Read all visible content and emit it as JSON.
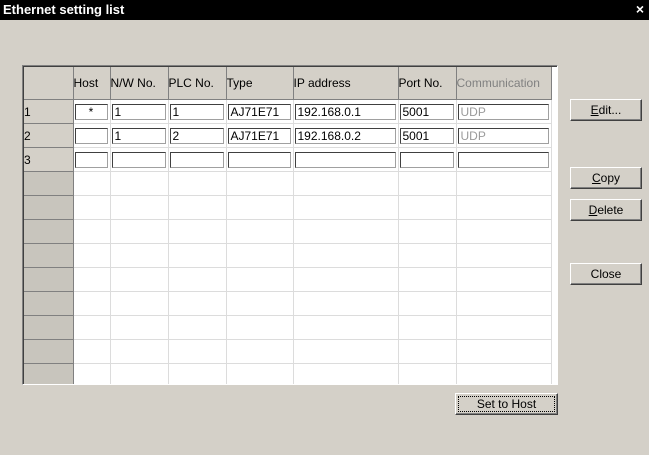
{
  "window": {
    "title": "Ethernet setting list",
    "close_glyph": "×"
  },
  "grid": {
    "columns": [
      "Host",
      "N/W No.",
      "PLC No.",
      "Type",
      "IP address",
      "Port No.",
      "Communication"
    ],
    "rows": [
      {
        "num": "1",
        "host": "*",
        "nw": "1",
        "plc": "1",
        "type": "AJ71E71",
        "ip": "192.168.0.1",
        "port": "5001",
        "comm": "UDP"
      },
      {
        "num": "2",
        "host": "",
        "nw": "1",
        "plc": "2",
        "type": "AJ71E71",
        "ip": "192.168.0.2",
        "port": "5001",
        "comm": "UDP"
      },
      {
        "num": "3",
        "host": "",
        "nw": "",
        "plc": "",
        "type": "",
        "ip": "",
        "port": "",
        "comm": ""
      }
    ]
  },
  "buttons": {
    "edit": {
      "mnemonic": "E",
      "rest": "dit..."
    },
    "copy": {
      "mnemonic": "C",
      "rest": "opy"
    },
    "delete": {
      "mnemonic": "D",
      "rest": "elete"
    },
    "close": "Close",
    "set_to_host": "Set to Host"
  }
}
